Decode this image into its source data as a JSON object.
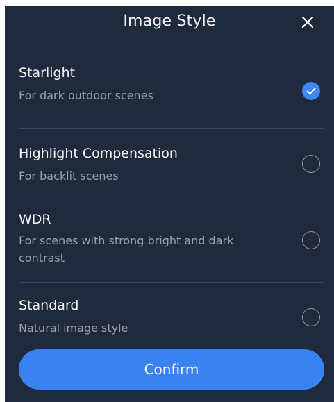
{
  "header": {
    "title": "Image Style",
    "close_icon": "close-icon"
  },
  "options": [
    {
      "title": "Starlight",
      "description": "For dark outdoor scenes",
      "selected": true
    },
    {
      "title": "Highlight Compensation",
      "description": "For backlit scenes",
      "selected": false
    },
    {
      "title": "WDR",
      "description": "For scenes with strong bright and dark contrast",
      "selected": false
    },
    {
      "title": "Standard",
      "description": "Natural image style",
      "selected": false
    }
  ],
  "confirm_label": "Confirm",
  "colors": {
    "background": "#1f2b3c",
    "accent": "#3a82f1",
    "divider": "#394659",
    "secondary_text": "#97a1ae"
  }
}
